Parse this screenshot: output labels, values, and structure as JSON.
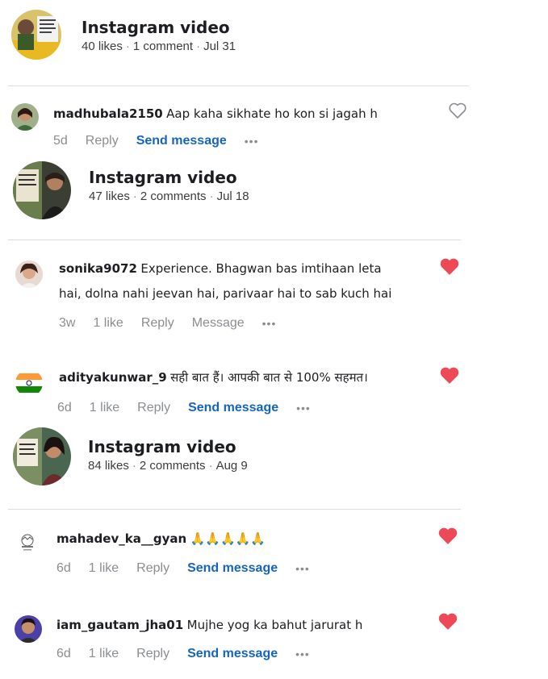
{
  "posts": [
    {
      "title": "Instagram video",
      "likes": "40 likes",
      "comments": "1 comment",
      "date": "Jul 31"
    },
    {
      "title": "Instagram video",
      "likes": "47 likes",
      "comments": "2 comments",
      "date": "Jul 18"
    },
    {
      "title": "Instagram video",
      "likes": "84 likes",
      "comments": "2 comments",
      "date": "Aug 9"
    }
  ],
  "comments": [
    {
      "user": "madhubala2150",
      "text": "Aap kaha sikhate ho kon si jagah h",
      "time": "5d",
      "reply": "Reply",
      "action": "Send message",
      "more": "•••",
      "liked": false
    },
    {
      "user": "sonika9072",
      "text": "Experience. Bhagwan bas imtihaan leta",
      "text2": "hai, dolna nahi jeevan hai, parivaar hai to sab kuch hai",
      "time": "3w",
      "likes": "1 like",
      "reply": "Reply",
      "action": "Message",
      "more": "•••",
      "liked": true
    },
    {
      "user": "adityakunwar_9",
      "text": "सही बात हैं। आपकी बात से 100% सहमत।",
      "time": "6d",
      "likes": "1 like",
      "reply": "Reply",
      "action": "Send message",
      "more": "•••",
      "liked": true
    },
    {
      "user": "mahadev_ka__gyan",
      "text": "🙏🙏🙏🙏🙏",
      "time": "6d",
      "likes": "1 like",
      "reply": "Reply",
      "action": "Send message",
      "more": "•••",
      "liked": true
    },
    {
      "user": "iam_gautam_jha01",
      "text": "Mujhe yog ka bahut jarurat h",
      "time": "6d",
      "likes": "1 like",
      "reply": "Reply",
      "action": "Send message",
      "more": "•••",
      "liked": true
    }
  ],
  "colors": {
    "heart": "#ed4956",
    "link": "#1565c0",
    "muted": "#8a8d91"
  },
  "icons": {
    "heart_outline": "heart-outline-icon",
    "heart_filled": "heart-filled-icon",
    "more": "more-icon"
  }
}
